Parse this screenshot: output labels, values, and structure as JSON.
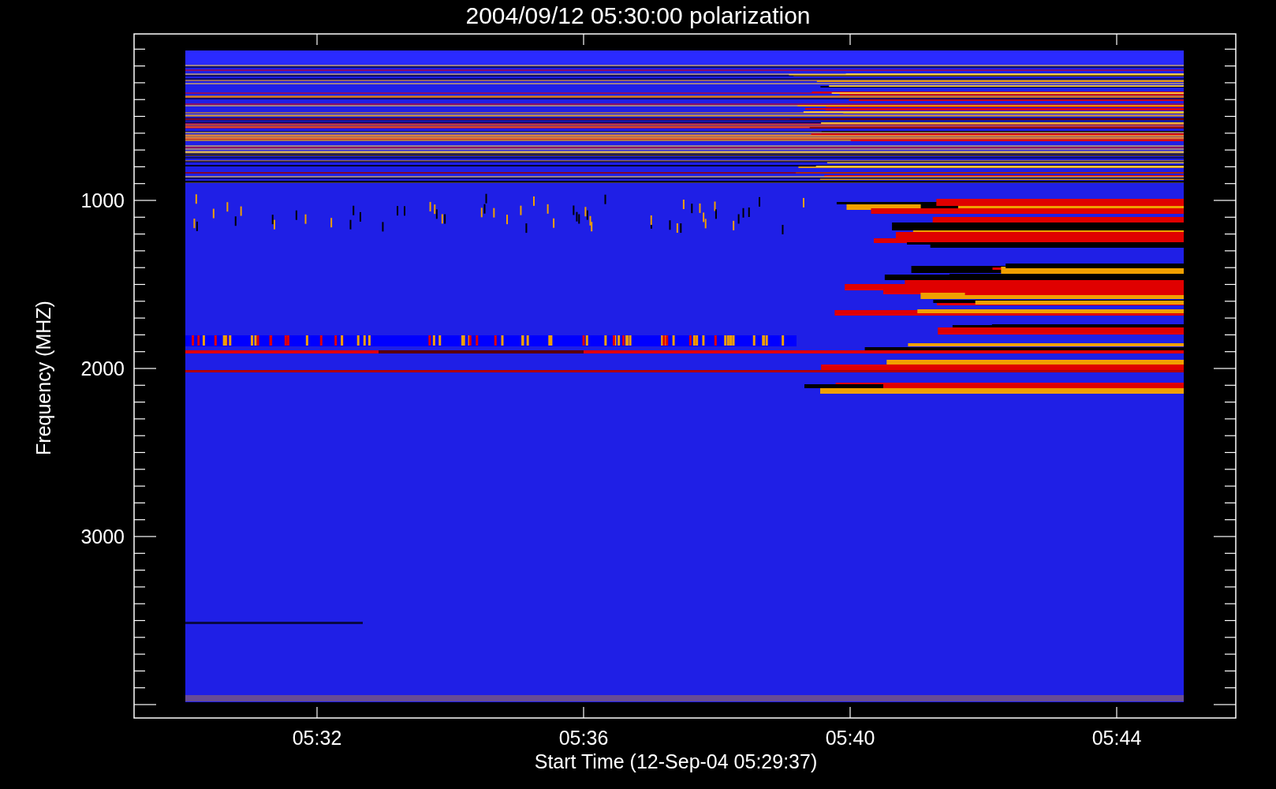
{
  "plot": {
    "title": "2004/09/12 05:30:00 polarization",
    "x_axis": {
      "label": "Start Time (12-Sep-04 05:29:37)",
      "tick_labels": [
        "05:32",
        "05:36",
        "05:40",
        "05:44"
      ]
    },
    "y_axis": {
      "label": "Frequency (MHZ)",
      "tick_labels": [
        "1000",
        "2000",
        "3000"
      ]
    }
  }
}
